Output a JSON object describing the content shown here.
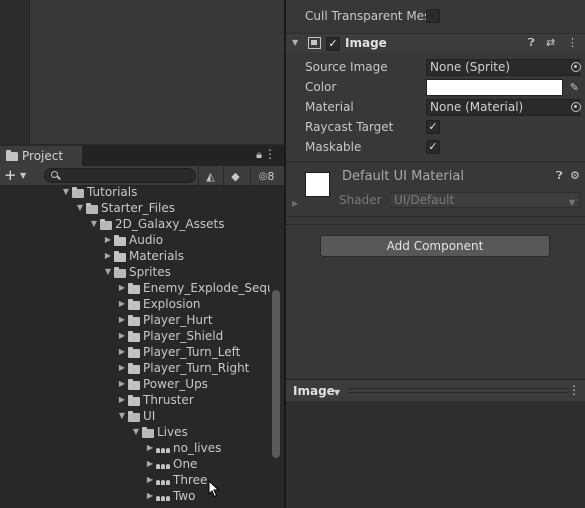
{
  "project": {
    "tab_label": "Project",
    "hidden_count": "8",
    "tree": [
      {
        "label": "Tutorials",
        "depth": 0,
        "kind": "folder",
        "expanded": true
      },
      {
        "label": "Starter_Files",
        "depth": 1,
        "kind": "folder",
        "expanded": true
      },
      {
        "label": "2D_Galaxy_Assets",
        "depth": 2,
        "kind": "folder",
        "expanded": true
      },
      {
        "label": "Audio",
        "depth": 3,
        "kind": "folder",
        "expanded": false
      },
      {
        "label": "Materials",
        "depth": 3,
        "kind": "folder",
        "expanded": false
      },
      {
        "label": "Sprites",
        "depth": 3,
        "kind": "folder",
        "expanded": true
      },
      {
        "label": "Enemy_Explode_Seque",
        "depth": 4,
        "kind": "folder",
        "expanded": false
      },
      {
        "label": "Explosion",
        "depth": 4,
        "kind": "folder",
        "expanded": false
      },
      {
        "label": "Player_Hurt",
        "depth": 4,
        "kind": "folder",
        "expanded": false
      },
      {
        "label": "Player_Shield",
        "depth": 4,
        "kind": "folder",
        "expanded": false
      },
      {
        "label": "Player_Turn_Left",
        "depth": 4,
        "kind": "folder",
        "expanded": false
      },
      {
        "label": "Player_Turn_Right",
        "depth": 4,
        "kind": "folder",
        "expanded": false
      },
      {
        "label": "Power_Ups",
        "depth": 4,
        "kind": "folder",
        "expanded": false
      },
      {
        "label": "Thruster",
        "depth": 4,
        "kind": "folder",
        "expanded": false
      },
      {
        "label": "UI",
        "depth": 4,
        "kind": "folder",
        "expanded": true
      },
      {
        "label": "Lives",
        "depth": 5,
        "kind": "folder",
        "expanded": true
      },
      {
        "label": "no_lives",
        "depth": 6,
        "kind": "sprite",
        "expanded": false
      },
      {
        "label": "One",
        "depth": 6,
        "kind": "sprite",
        "expanded": false
      },
      {
        "label": "Three",
        "depth": 6,
        "kind": "sprite",
        "expanded": false
      },
      {
        "label": "Two",
        "depth": 6,
        "kind": "sprite",
        "expanded": false
      }
    ]
  },
  "inspector": {
    "cull_label": "Cull Transparent Mes",
    "component_title": "Image",
    "source_image_label": "Source Image",
    "source_image_value": "None (Sprite)",
    "color_label": "Color",
    "color_value": "#ffffff",
    "material_label": "Material",
    "material_value": "None (Material)",
    "raycast_label": "Raycast Target",
    "raycast_checked": true,
    "maskable_label": "Maskable",
    "maskable_checked": true,
    "default_material_name": "Default UI Material",
    "shader_label": "Shader",
    "shader_value": "UI/Default",
    "add_component_label": "Add Component",
    "preview_title": "Image"
  }
}
